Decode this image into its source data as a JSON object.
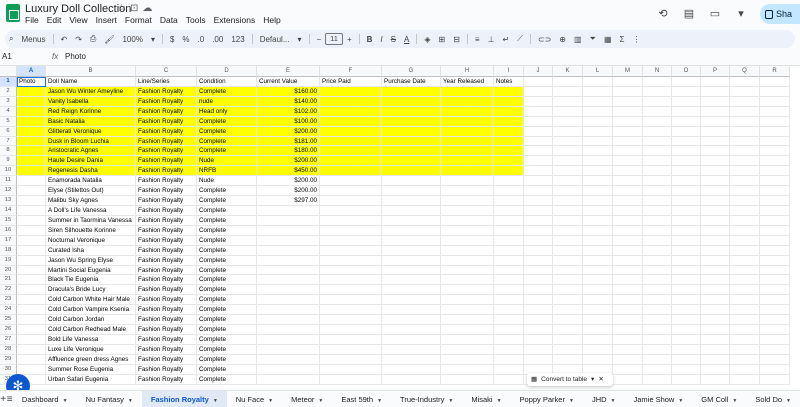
{
  "app": {
    "title": "Luxury Doll Collection",
    "menu": [
      "File",
      "Edit",
      "View",
      "Insert",
      "Format",
      "Data",
      "Tools",
      "Extensions",
      "Help"
    ],
    "share_label": "Sha"
  },
  "toolbar": {
    "menus_label": "Menus",
    "zoom": "100%",
    "currency": "$",
    "percent": "%",
    "dec_dec": ".0",
    "dec_inc": ".00",
    "num_format": "123",
    "font": "Defaul...",
    "font_size": "11"
  },
  "formula": {
    "cell_ref": "A1",
    "fx": "fx",
    "value": "Photo"
  },
  "columns": [
    "A",
    "B",
    "C",
    "D",
    "E",
    "F",
    "G",
    "H",
    "I",
    "J",
    "K",
    "L",
    "M",
    "N",
    "O",
    "P",
    "Q",
    "R"
  ],
  "headers": [
    "Photo",
    "Doll Name",
    "Line/Series",
    "Condition",
    "Current Value",
    "Price Paid",
    "Purchase Date",
    "Year Released",
    "Notes"
  ],
  "rows": [
    {
      "name": "Jason Wu Winter Ameyline",
      "series": "Fashion Royalty",
      "condition": "Complete",
      "value": "$160.00",
      "highlight": true
    },
    {
      "name": "Vanity Isabella",
      "series": "Fashion Royalty",
      "condition": "nude",
      "value": "$140.00",
      "highlight": true
    },
    {
      "name": "Red Reign Korinne",
      "series": "Fashion Royalty",
      "condition": "Head only",
      "value": "$102.00",
      "highlight": true
    },
    {
      "name": "Basic Natalia",
      "series": "Fashion Royalty",
      "condition": "Complete",
      "value": "$100.00",
      "highlight": true
    },
    {
      "name": "Glitterati Veronique",
      "series": "Fashion Royalty",
      "condition": "Complete",
      "value": "$200.00",
      "highlight": true
    },
    {
      "name": "Dusk in Bloom Luchia",
      "series": "Fashion Royalty",
      "condition": "Complete",
      "value": "$181.00",
      "highlight": true
    },
    {
      "name": "Aristocratic Agnes",
      "series": "Fashion Royalty",
      "condition": "Complete",
      "value": "$180.00",
      "highlight": true
    },
    {
      "name": "Haute Desire Dania",
      "series": "Fashion Royalty",
      "condition": "Nude",
      "value": "$200.00",
      "highlight": true
    },
    {
      "name": "Regenesis Dasha",
      "series": "Fashion Royalty",
      "condition": "NRFB",
      "value": "$450.00",
      "highlight": true
    },
    {
      "name": "Enamorada Natalia",
      "series": "Fashion Royalty",
      "condition": "Nude",
      "value": "$200.00",
      "highlight": false
    },
    {
      "name": "Elyse (Stilettos Out)",
      "series": "Fashion Royalty",
      "condition": "Complete",
      "value": "$200.00",
      "highlight": false
    },
    {
      "name": "Malibu Sky Agnes",
      "series": "Fashion Royalty",
      "condition": "Complete",
      "value": "$297.00",
      "highlight": false
    },
    {
      "name": "A Doll's Life Vanessa",
      "series": "Fashion Royalty",
      "condition": "Complete",
      "value": "",
      "highlight": false
    },
    {
      "name": "Summer in Taormina Vanessa",
      "series": "Fashion Royalty",
      "condition": "Complete",
      "value": "",
      "highlight": false
    },
    {
      "name": "Siren Silhouette Korinne",
      "series": "Fashion Royalty",
      "condition": "Complete",
      "value": "",
      "highlight": false
    },
    {
      "name": "Nocturnal Veronique",
      "series": "Fashion Royalty",
      "condition": "Complete",
      "value": "",
      "highlight": false
    },
    {
      "name": "Curated Isha",
      "series": "Fashion Royalty",
      "condition": "Complete",
      "value": "",
      "highlight": false
    },
    {
      "name": "Jason Wu Spring Elyse",
      "series": "Fashion Royalty",
      "condition": "Complete",
      "value": "",
      "highlight": false
    },
    {
      "name": "Martini Social Eugenia",
      "series": "Fashion Royalty",
      "condition": "Complete",
      "value": "",
      "highlight": false
    },
    {
      "name": "Black Tie Eugenia",
      "series": "Fashion Royalty",
      "condition": "Complete",
      "value": "",
      "highlight": false
    },
    {
      "name": "Dracula's Bride Lucy",
      "series": "Fashion Royalty",
      "condition": "Complete",
      "value": "",
      "highlight": false
    },
    {
      "name": "Cold Carbon White Hair Male",
      "series": "Fashion Royalty",
      "condition": "Complete",
      "value": "",
      "highlight": false
    },
    {
      "name": "Cold Carbon Vampire Ksenia",
      "series": "Fashion Royalty",
      "condition": "Complete",
      "value": "",
      "highlight": false
    },
    {
      "name": "Cold Carbon Jordan",
      "series": "Fashion Royalty",
      "condition": "Complete",
      "value": "",
      "highlight": false
    },
    {
      "name": "Cold Carbon Redhead Male",
      "series": "Fashion Royalty",
      "condition": "Complete",
      "value": "",
      "highlight": false
    },
    {
      "name": "Bold Life Vanessa",
      "series": "Fashion Royalty",
      "condition": "Complete",
      "value": "",
      "highlight": false
    },
    {
      "name": "Luxe Life Veronique",
      "series": "Fashion Royalty",
      "condition": "Complete",
      "value": "",
      "highlight": false
    },
    {
      "name": "Affluence green dress Agnes",
      "series": "Fashion Royalty",
      "condition": "Complete",
      "value": "",
      "highlight": false
    },
    {
      "name": "Summer Rose Eugenia",
      "series": "Fashion Royalty",
      "condition": "Complete",
      "value": "",
      "highlight": false
    },
    {
      "name": "Urban Safari Eugenia",
      "series": "Fashion Royalty",
      "condition": "Complete",
      "value": "",
      "highlight": false
    }
  ],
  "convert_label": "Convert to table",
  "tabs": [
    "Dashboard",
    "Nu Fantasy",
    "Fashion Royalty",
    "Nu Face",
    "Meteor",
    "East 59th",
    "True-Industry",
    "Misaki",
    "Poppy Parker",
    "JHD",
    "Jamie Show",
    "GM Coll",
    "Sold Do"
  ],
  "active_tab": "Fashion Royalty",
  "colors": {
    "highlight": "#ffff00",
    "accent": "#0b57d0",
    "share_bg": "#c2e7ff"
  }
}
